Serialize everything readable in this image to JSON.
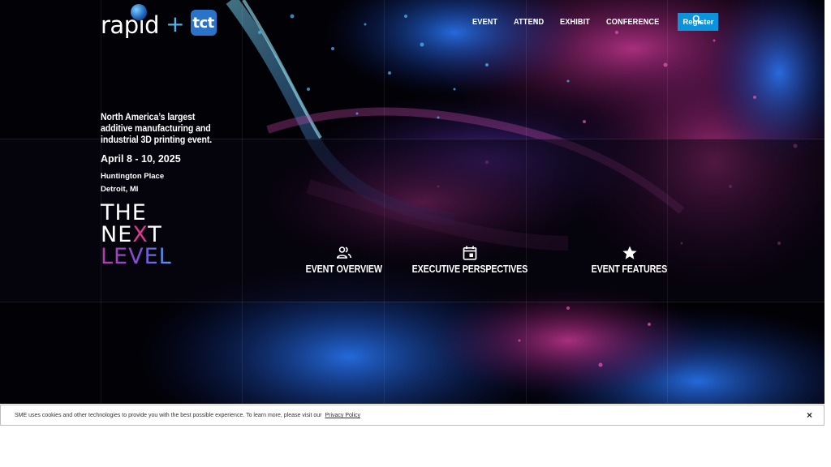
{
  "brand": {
    "logo_word": "rapid",
    "logo_plus": "+",
    "logo_badge": "tct"
  },
  "nav": {
    "items": [
      "EVENT",
      "ATTEND",
      "EXHIBIT",
      "CONFERENCE"
    ],
    "register_label": "Register",
    "search_icon": "search-icon"
  },
  "hero": {
    "tagline": "North America’s largest additive manufacturing and industrial 3D printing event.",
    "dates": "April 8 - 10, 2025",
    "venue": "Huntington Place",
    "city": "Detroit, MI",
    "next_level": {
      "line1": "THE",
      "line2_a": "NE",
      "line2_x": "X",
      "line2_b": "T",
      "line3": "LEVEL"
    }
  },
  "features": [
    {
      "label": "EVENT OVERVIEW",
      "icon": "people-icon"
    },
    {
      "label": "EXECUTIVE PERSPECTIVES",
      "icon": "calendar-icon"
    },
    {
      "label": "EVENT FEATURES",
      "icon": "star-icon"
    }
  ],
  "cookie": {
    "text": "SME uses cookies and other technologies to provide you with the best possible experience. To learn more, please visit our",
    "link": "Privacy Policy",
    "close": "×"
  },
  "colors": {
    "accent_blue": "#0c93dc",
    "magenta": "#e0378f",
    "background": "#020106"
  }
}
